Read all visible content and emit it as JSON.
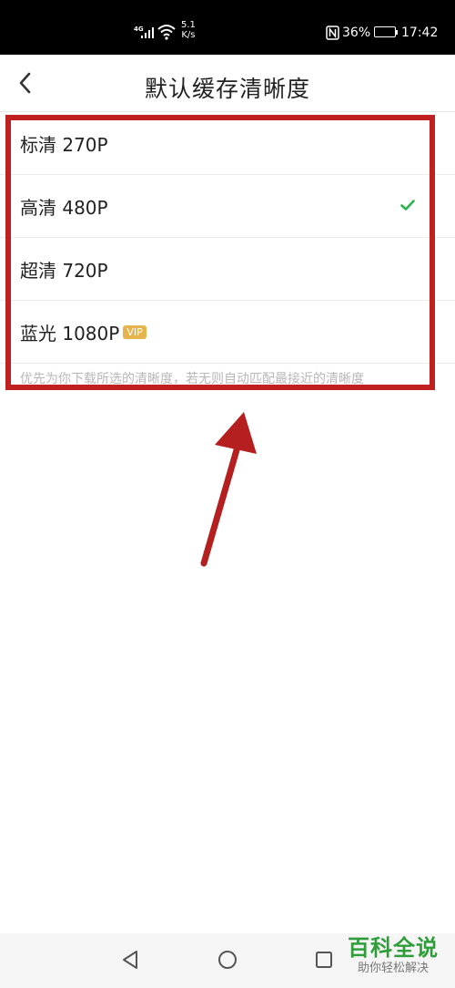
{
  "status_bar": {
    "network_type": "4G",
    "net_speed_value": "5.1",
    "net_speed_unit": "K/s",
    "battery_percent": "36%",
    "time": "17:42"
  },
  "header": {
    "title": "默认缓存清晰度",
    "back_icon": "chevron-left-icon"
  },
  "options": [
    {
      "label": "标清 270P",
      "selected": false
    },
    {
      "label": "高清 480P",
      "selected": true
    },
    {
      "label": "超清 720P",
      "selected": false
    },
    {
      "label": "蓝光 1080P",
      "selected": false,
      "badge": "VIP"
    }
  ],
  "hint": "优先为你下载所选的清晰度，若无则自动匹配最接近的清晰度",
  "colors": {
    "check": "#2bb24c",
    "vip_badge": "#e7b34d",
    "annotation_red": "#c02020",
    "watermark_green": "#2f9e3a"
  },
  "watermark": {
    "title": "百科全说",
    "subtitle": "助你轻松解决"
  }
}
